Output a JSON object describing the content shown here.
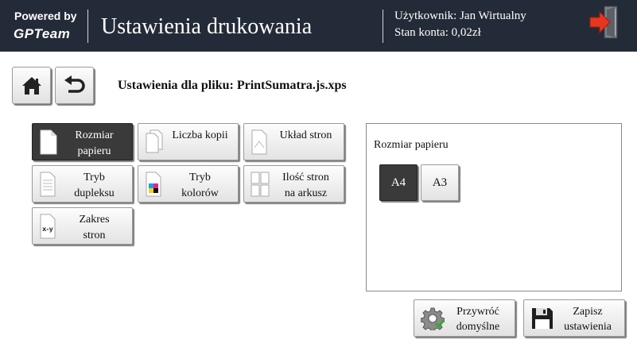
{
  "header": {
    "powered_by": "Powered by",
    "brand": "GPTeam",
    "title": "Ustawienia drukowania",
    "user_line": "Użytkownik: Jan Wirtualny",
    "balance_line": "Stan konta: 0,02zł",
    "logout_icon": "exit-door-arrow-icon"
  },
  "nav": {
    "home_icon": "home-icon",
    "back_icon": "undo-arrow-icon",
    "file_label": "Ustawienia dla pliku: PrintSumatra.js.xps"
  },
  "categories": [
    {
      "label": "Rozmiar\npapieru",
      "icon": "page-icon",
      "active": true
    },
    {
      "label": "Liczba kopii",
      "icon": "copies-icon",
      "active": false
    },
    {
      "label": "Układ stron",
      "icon": "page-layout-icon",
      "active": false
    },
    {
      "label": "Tryb\ndupleksu",
      "icon": "duplex-icon",
      "active": false
    },
    {
      "label": "Tryb\nkolorów",
      "icon": "color-mode-icon",
      "active": false
    },
    {
      "label": "Ilość stron\nna arkusz",
      "icon": "pages-per-sheet-icon",
      "active": false
    },
    {
      "label": "Zakres\nstron",
      "icon": "page-range-icon",
      "active": false
    }
  ],
  "panel": {
    "title": "Rozmiar papieru",
    "options": [
      {
        "label": "A4",
        "selected": true
      },
      {
        "label": "A3",
        "selected": false
      }
    ]
  },
  "actions": {
    "restore_label": "Przywróć\ndomyślne",
    "restore_icon": "gear-icon",
    "save_label": "Zapisz\nustawienia",
    "save_icon": "floppy-disk-icon"
  },
  "colors": {
    "header_bg": "#242b38",
    "active_bg": "#3a3a3a",
    "logout_red": "#e8361e"
  }
}
